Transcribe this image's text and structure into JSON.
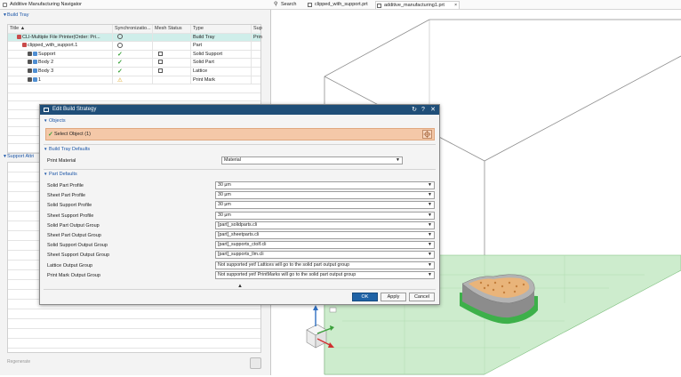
{
  "navigator": {
    "title": "Additive Manufacturing Navigator",
    "build_tray_section": "Build Tray",
    "support_section": "Support Attri",
    "columns": [
      "Title",
      "Synchronizatio...",
      "Mesh Status",
      "Type",
      "Suppor"
    ],
    "rows": [
      {
        "title": "CLI-Multiple File Printer(Order: Pri...",
        "sync": "sync",
        "mesh": "",
        "type": "Build Tray",
        "support": "Printer I",
        "selected": true,
        "indent": 1
      },
      {
        "title": "clipped_with_support.1",
        "sync": "sync",
        "mesh": "",
        "type": "Part",
        "support": "",
        "selected": false,
        "indent": 2
      },
      {
        "title": "Support",
        "sync": "check",
        "mesh": "box",
        "type": "Solid Support",
        "support": "",
        "selected": false,
        "indent": 3
      },
      {
        "title": "Body 2",
        "sync": "check",
        "mesh": "box",
        "type": "Solid Part",
        "support": "",
        "selected": false,
        "indent": 3
      },
      {
        "title": "Body 3",
        "sync": "check",
        "mesh": "box",
        "type": "Lattice",
        "support": "",
        "selected": false,
        "indent": 3
      },
      {
        "title": "1",
        "sync": "warn",
        "mesh": "",
        "type": "Print Mark",
        "support": "",
        "selected": false,
        "indent": 3
      }
    ],
    "regenerate_label": "Regenerate"
  },
  "tabs": {
    "search": "Search",
    "tab1": "clipped_with_support.prt",
    "tab2": "additive_manufacturing1.prt"
  },
  "dialog": {
    "title": "Edit Build Strategy",
    "objects_section": "Objects",
    "select_object": "Select Object (1)",
    "defaults_section": "Build Tray Defaults",
    "print_material_label": "Print Material",
    "print_material_value": "Material",
    "part_defaults_section": "Part Defaults",
    "fields": [
      {
        "label": "Solid Part Profile",
        "value": "30 μm"
      },
      {
        "label": "Sheet Part Profile",
        "value": "30 μm"
      },
      {
        "label": "Solid Support Profile",
        "value": "30 μm"
      },
      {
        "label": "Sheet Support Profile",
        "value": "30 μm"
      },
      {
        "label": "Solid Part Output Group",
        "value": "[part]_solidparts.cli"
      },
      {
        "label": "Sheet Part Output Group",
        "value": "[part]_sheetparts.cli"
      },
      {
        "label": "Solid Support Output Group",
        "value": "[part]_supports_ctolf.cli"
      },
      {
        "label": "Sheet Support Output Group",
        "value": "[part]_supports_llm.cli"
      },
      {
        "label": "Lattice Output Group",
        "value": "Not supported yet! Lattices will go to the solid part output group"
      },
      {
        "label": "Print Mark Output Group",
        "value": "Not supported yet! PrintMarks will go to the solid part output group"
      }
    ],
    "ok": "OK",
    "apply": "Apply",
    "cancel": "Cancel"
  },
  "colors": {
    "dialog_title": "#1f4e78",
    "selection_bg": "#f4c8a8",
    "build_plate": "#cdeccd",
    "part_orange": "#e9b47a",
    "part_gray": "#8c8c8c",
    "part_green": "#3db04a"
  }
}
